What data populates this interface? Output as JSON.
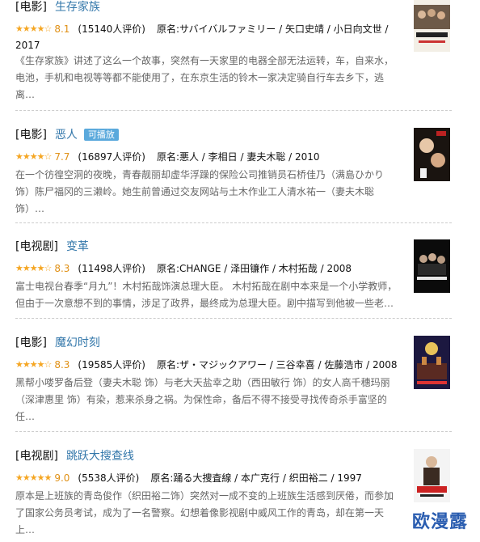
{
  "items": [
    {
      "category": "[电影]",
      "title": "生存家族",
      "badge": "",
      "stars": "★★★★☆",
      "rating": "8.1",
      "count": "(15140人评价)",
      "original": "原名:サバイバルファミリー / 矢口史靖 / 小日向文世 /",
      "original2": "2017",
      "description": "《生存家族》讲述了这么一个故事，突然有一天家里的电器全部无法运转，车，自来水，电池，手机和电视等等都不能使用了，在东京生活的铃木一家决定骑自行车去乡下，逃离…",
      "poster_title": "サバイバルファミリー"
    },
    {
      "category": "[电影]",
      "title": "恶人",
      "badge": "可播放",
      "stars": "★★★★☆",
      "rating": "7.7",
      "count": "(16897人评价)",
      "original": "原名:悪人 / 李相日 / 妻夫木聡 / 2010",
      "original2": "",
      "description": "在一个彷徨空洞的夜晚，青春靓丽却虚华浮躁的保险公司推销员石桥佳乃（满島ひかり 饰）陈尸福冈的三濑岭。她生前曾通过交友网站与土木作业工人清水祐一（妻夫木聡 饰）…",
      "poster_title": "悪人"
    },
    {
      "category": "[电视剧]",
      "title": "变革",
      "badge": "",
      "stars": "★★★★☆",
      "rating": "8.3",
      "count": "(11498人评价)",
      "original": "原名:CHANGE / 泽田镰作 / 木村拓哉 / 2008",
      "original2": "",
      "description": "富士电视台春季“月九”！木村拓哉饰演总理大臣。 木村拓哉在剧中本来是一个小学教师，但由于一次意想不到的事情，涉足了政界，最终成为总理大臣。剧中描写到他被一些老…",
      "poster_title": "CHANGE"
    },
    {
      "category": "[电影]",
      "title": "魔幻时刻",
      "badge": "",
      "stars": "★★★★☆",
      "rating": "8.3",
      "count": "(19585人评价)",
      "original": "原名:ザ・マジックアワー / 三谷幸喜 / 佐藤浩市 / 2008",
      "original2": "",
      "description": "黑帮小喽罗备后登（妻夫木聪 饰）与老大天盐幸之助（西田敏行 饰）的女人高千穗玛丽（深津惠里 饰）有染，惹来杀身之祸。为保性命，备后不得不接受寻找传奇杀手富坚的任…",
      "poster_title": "ザ・マジックアワー"
    },
    {
      "category": "[电视剧]",
      "title": "跳跃大搜查线",
      "badge": "",
      "stars": "★★★★★",
      "rating": "9.0",
      "count": "(5538人评价)",
      "original": "原名:踊る大捜査線 / 本广克行 / 织田裕二 / 1997",
      "original2": "",
      "description": "原本是上班族的青岛俊作（织田裕二饰）突然对一成不变的上班族生活感到厌倦，而参加了国家公务员考试，成为了一名警察。幻想着像影视剧中威风工作的青岛，却在第一天上…",
      "poster_title": "大捜査線"
    }
  ],
  "watermark": "欧漫露",
  "colors": {
    "link": "#3377aa",
    "star": "#f5a623",
    "badge": "#5aa9dc",
    "muted": "#666666",
    "watermark": "#2a5db0"
  }
}
